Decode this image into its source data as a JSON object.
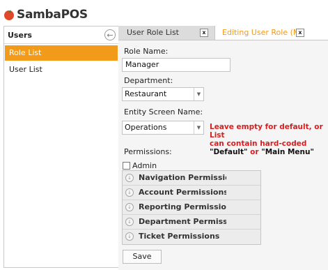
{
  "app": {
    "logo_text": "SambaPOS"
  },
  "sidebar": {
    "title": "Users",
    "items": [
      {
        "label": "Role List",
        "active": true
      },
      {
        "label": "User List",
        "active": false
      }
    ]
  },
  "tabs": [
    {
      "label": "User Role List",
      "close": "x",
      "active": false
    },
    {
      "label": "Editing User Role (Ma",
      "close": "x",
      "active": true
    }
  ],
  "form": {
    "role_name_label": "Role Name:",
    "role_name_value": "Manager",
    "department_label": "Department:",
    "department_value": "Restaurant",
    "entity_screen_label": "Entity Screen Name:",
    "entity_screen_value": "Operations",
    "hint_line1": "Leave empty for default, or List",
    "hint_line2": "can contain hard-coded",
    "hint_q1": "\"Default\"",
    "hint_or": " or ",
    "hint_q2": "\"Main Menu\"",
    "permissions_label": "Permissions:",
    "admin_label": "Admin",
    "admin_checked": false,
    "permission_groups": [
      "Navigation Permission:",
      "Account Permissions",
      "Reporting Permissions",
      "Department Permissio",
      "Ticket Permissions"
    ],
    "save_label": "Save"
  },
  "colors": {
    "accent": "#f29a1a",
    "hint_red": "#d42020"
  }
}
